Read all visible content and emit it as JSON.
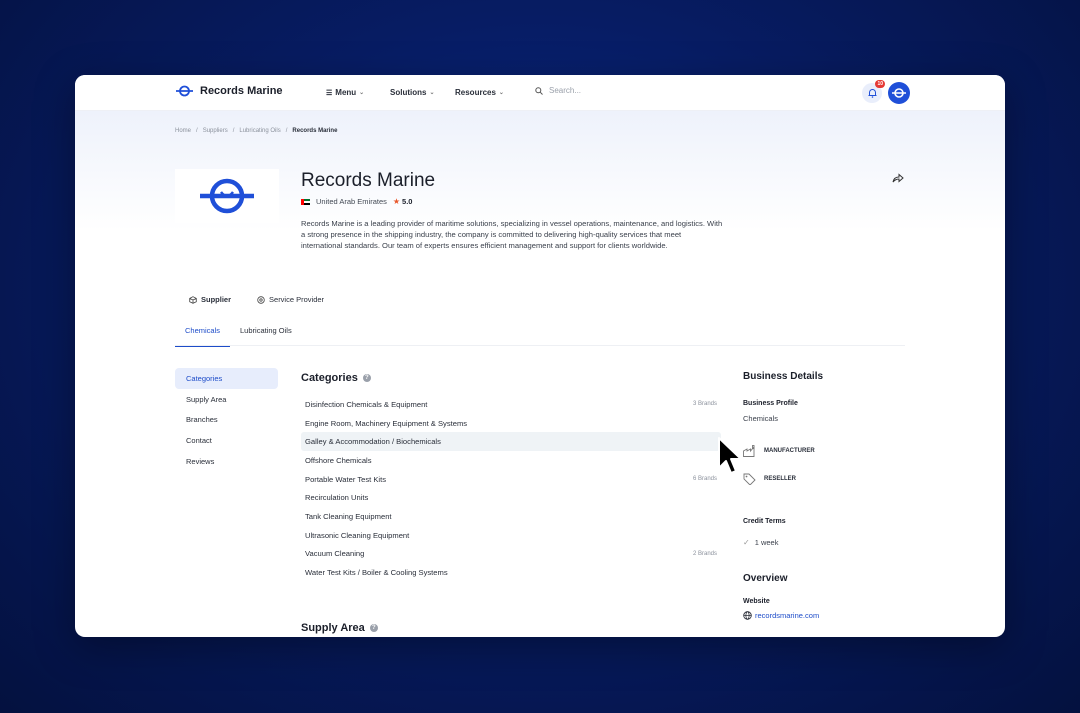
{
  "app": {
    "brand": "Records Marine",
    "brand_color": "#1f4fd8"
  },
  "nav": {
    "items": [
      {
        "label": "Menu"
      },
      {
        "label": "Solutions"
      },
      {
        "label": "Resources"
      }
    ],
    "search_placeholder": "Search...",
    "notification_count": "10"
  },
  "breadcrumb": [
    "Home",
    "Suppliers",
    "Lubricating Oils",
    "Records Marine"
  ],
  "company": {
    "name": "Records Marine",
    "country": "United Arab Emirates",
    "rating": "5.0",
    "description": "Records Marine is a leading provider of maritime solutions, specializing in vessel operations, maintenance, and logistics. With a strong presence in the shipping industry, the company is committed to delivering high-quality services that meet international standards. Our team of experts ensures efficient management and support for clients worldwide."
  },
  "role_tabs": [
    "Supplier",
    "Service Provider"
  ],
  "sub_tabs": [
    "Chemicals",
    "Lubricating Oils"
  ],
  "sidenav": [
    "Categories",
    "Supply Area",
    "Branches",
    "Contact",
    "Reviews"
  ],
  "categories": {
    "title": "Categories",
    "items": [
      {
        "name": "Disinfection Chemicals & Equipment",
        "brands": "3 Brands"
      },
      {
        "name": "Engine Room, Machinery Equipment & Systems",
        "brands": ""
      },
      {
        "name": "Galley & Accommodation / Biochemicals",
        "brands": ""
      },
      {
        "name": "Offshore Chemicals",
        "brands": ""
      },
      {
        "name": "Portable Water Test Kits",
        "brands": "6 Brands"
      },
      {
        "name": "Recirculation Units",
        "brands": ""
      },
      {
        "name": "Tank Cleaning Equipment",
        "brands": ""
      },
      {
        "name": "Ultrasonic Cleaning Equipment",
        "brands": ""
      },
      {
        "name": "Vacuum Cleaning",
        "brands": "2 Brands"
      },
      {
        "name": "Water Test Kits / Boiler & Cooling Systems",
        "brands": ""
      }
    ]
  },
  "supply_area": {
    "title": "Supply Area"
  },
  "business": {
    "title": "Business Details",
    "profile_label": "Business Profile",
    "profile_value": "Chemicals",
    "tags": [
      "MANUFACTURER",
      "RESELLER"
    ],
    "credit_label": "Credit Terms",
    "credit_value": "1 week",
    "overview_title": "Overview",
    "website_label": "Website",
    "website_value": "recordsmarine.com"
  }
}
